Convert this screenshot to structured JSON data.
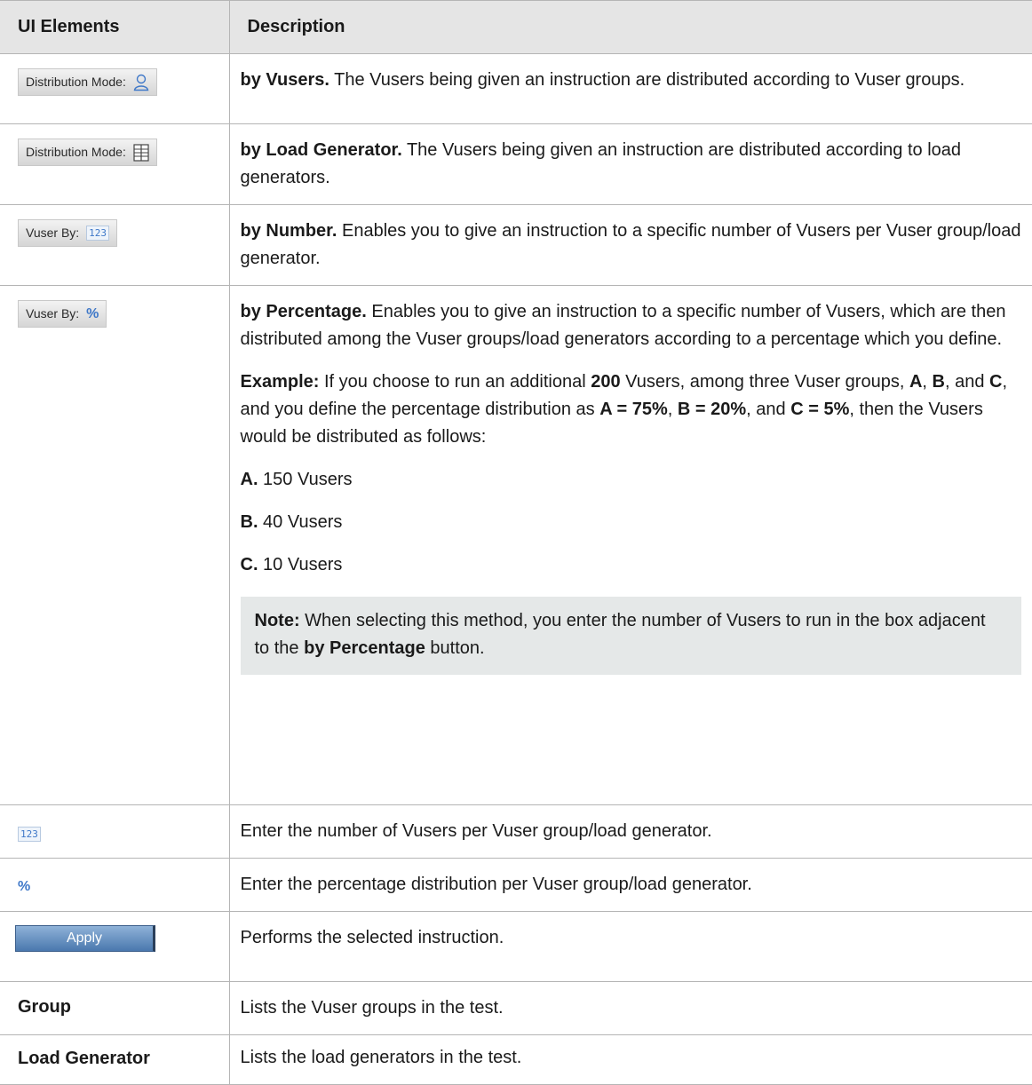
{
  "header": {
    "col1": "UI Elements",
    "col2": "Description"
  },
  "rows": {
    "r0": {
      "chip_label": "Distribution Mode:",
      "lead": "by Vusers.",
      "text": " The Vusers being given an instruction are distributed according to Vuser groups."
    },
    "r1": {
      "chip_label": "Distribution Mode:",
      "lead": "by Load Generator.",
      "text": " The Vusers being given an instruction are distributed according to load generators."
    },
    "r2": {
      "chip_label": "Vuser By:",
      "chip_icon": "123",
      "lead": "by Number.",
      "text": " Enables you to give an instruction to a specific number of Vusers per Vuser group/load generator."
    },
    "r3": {
      "chip_label": "Vuser By:",
      "chip_icon": "%",
      "lead": "by Percentage.",
      "text": " Enables you to give an instruction to a specific number of Vusers, which are then distributed among the Vuser groups/load generators according to a percentage which you define.",
      "example": {
        "b0": "Example:",
        "t0": " If you choose to run an additional ",
        "b1": "200",
        "t1": " Vusers, among three Vuser groups, ",
        "b2": "A",
        "t2": ", ",
        "b3": "B",
        "t3": ", and ",
        "b4": "C",
        "t4": ", and you define the percentage distribution as ",
        "b5": "A = 75%",
        "t5": ", ",
        "b6": "B = 20%",
        "t6": ", and ",
        "b7": "C = 5%",
        "t7": ", then the Vusers would be distributed as follows:"
      },
      "items": [
        {
          "b": "A.",
          "t": " 150 Vusers"
        },
        {
          "b": "B.",
          "t": " 40 Vusers"
        },
        {
          "b": "C.",
          "t": " 10 Vusers"
        }
      ],
      "note": {
        "b0": "Note:",
        "t0": " When selecting this method, you enter the number of Vusers to run in the box adjacent to the ",
        "b1": "by Percentage",
        "t1": " button."
      }
    },
    "r4": {
      "icon": "123",
      "text": "Enter the number of Vusers per Vuser group/load generator."
    },
    "r5": {
      "icon": "%",
      "text": "Enter the percentage distribution per Vuser group/load generator."
    },
    "r6": {
      "button": "Apply",
      "text": "Performs the selected instruction."
    },
    "r7": {
      "label": "Group",
      "text": "Lists the Vuser groups in the test."
    },
    "r8": {
      "label": "Load Generator",
      "text": "Lists the load generators in the test."
    }
  },
  "icons": {
    "vusers": "person-icon",
    "load_generator": "server-list-icon",
    "number": "number-123-icon",
    "percent": "percent-icon"
  },
  "colors": {
    "header_bg": "#e5e5e5",
    "note_bg": "#e5e8e8",
    "icon_blue": "#3f78c8",
    "apply_button": "#4a78ae",
    "border": "#b5b5b5"
  }
}
